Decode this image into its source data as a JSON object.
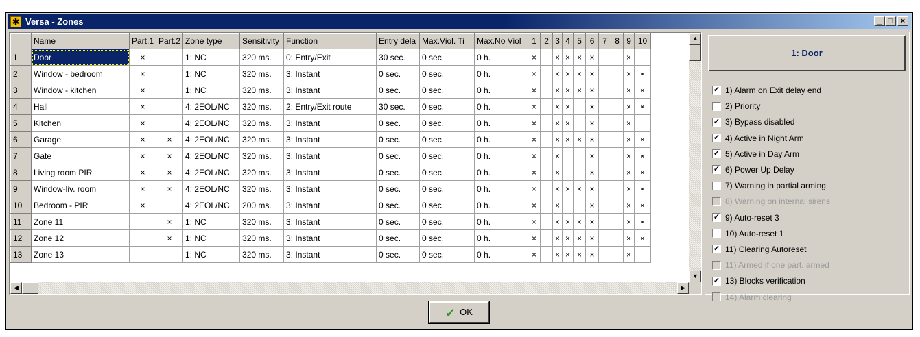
{
  "window": {
    "title": "Versa - Zones",
    "btn_min": "_",
    "btn_max": "□",
    "btn_close": "×"
  },
  "grid": {
    "columns": [
      "Name",
      "Part.1",
      "Part.2",
      "Zone type",
      "Sensitivity",
      "Function",
      "Entry dela",
      "Max.Viol. Ti",
      "Max.No Viol",
      "1",
      "2",
      "3",
      "4",
      "5",
      "6",
      "7",
      "8",
      "9",
      "10"
    ],
    "rows": [
      {
        "num": "1",
        "name": "Door",
        "p1": "×",
        "p2": "",
        "type": "1: NC",
        "sens": "320 ms.",
        "func": "0: Entry/Exit",
        "entry": "30 sec.",
        "maxviol": "0 sec.",
        "maxnoviol": "0 h.",
        "opts": [
          "×",
          "",
          "×",
          "×",
          "×",
          "×",
          "",
          "",
          "×",
          ""
        ]
      },
      {
        "num": "2",
        "name": "Window - bedroom",
        "p1": "×",
        "p2": "",
        "type": "1: NC",
        "sens": "320 ms.",
        "func": "3: Instant",
        "entry": "0 sec.",
        "maxviol": "0 sec.",
        "maxnoviol": "0 h.",
        "opts": [
          "×",
          "",
          "×",
          "×",
          "×",
          "×",
          "",
          "",
          "×",
          "×"
        ]
      },
      {
        "num": "3",
        "name": "Window - kitchen",
        "p1": "×",
        "p2": "",
        "type": "1: NC",
        "sens": "320 ms.",
        "func": "3: Instant",
        "entry": "0 sec.",
        "maxviol": "0 sec.",
        "maxnoviol": "0 h.",
        "opts": [
          "×",
          "",
          "×",
          "×",
          "×",
          "×",
          "",
          "",
          "×",
          "×"
        ]
      },
      {
        "num": "4",
        "name": "Hall",
        "p1": "×",
        "p2": "",
        "type": "4: 2EOL/NC",
        "sens": "320 ms.",
        "func": "2: Entry/Exit route",
        "entry": "30 sec.",
        "maxviol": "0 sec.",
        "maxnoviol": "0 h.",
        "opts": [
          "×",
          "",
          "×",
          "×",
          "",
          "×",
          "",
          "",
          "×",
          "×"
        ]
      },
      {
        "num": "5",
        "name": "Kitchen",
        "p1": "×",
        "p2": "",
        "type": "4: 2EOL/NC",
        "sens": "320 ms.",
        "func": "3: Instant",
        "entry": "0 sec.",
        "maxviol": "0 sec.",
        "maxnoviol": "0 h.",
        "opts": [
          "×",
          "",
          "×",
          "×",
          "",
          "×",
          "",
          "",
          "×",
          ""
        ]
      },
      {
        "num": "6",
        "name": "Garage",
        "p1": "×",
        "p2": "×",
        "type": "4: 2EOL/NC",
        "sens": "320 ms.",
        "func": "3: Instant",
        "entry": "0 sec.",
        "maxviol": "0 sec.",
        "maxnoviol": "0 h.",
        "opts": [
          "×",
          "",
          "×",
          "×",
          "×",
          "×",
          "",
          "",
          "×",
          "×"
        ]
      },
      {
        "num": "7",
        "name": "Gate",
        "p1": "×",
        "p2": "×",
        "type": "4: 2EOL/NC",
        "sens": "320 ms.",
        "func": "3: Instant",
        "entry": "0 sec.",
        "maxviol": "0 sec.",
        "maxnoviol": "0 h.",
        "opts": [
          "×",
          "",
          "×",
          "",
          "",
          "×",
          "",
          "",
          "×",
          "×"
        ]
      },
      {
        "num": "8",
        "name": "Living room PIR",
        "p1": "×",
        "p2": "×",
        "type": "4: 2EOL/NC",
        "sens": "320 ms.",
        "func": "3: Instant",
        "entry": "0 sec.",
        "maxviol": "0 sec.",
        "maxnoviol": "0 h.",
        "opts": [
          "×",
          "",
          "×",
          "",
          "",
          "×",
          "",
          "",
          "×",
          "×"
        ]
      },
      {
        "num": "9",
        "name": "Window-liv. room",
        "p1": "×",
        "p2": "×",
        "type": "4: 2EOL/NC",
        "sens": "320 ms.",
        "func": "3: Instant",
        "entry": "0 sec.",
        "maxviol": "0 sec.",
        "maxnoviol": "0 h.",
        "opts": [
          "×",
          "",
          "×",
          "×",
          "×",
          "×",
          "",
          "",
          "×",
          "×"
        ]
      },
      {
        "num": "10",
        "name": "Bedroom - PIR",
        "p1": "×",
        "p2": "",
        "type": "4: 2EOL/NC",
        "sens": "200 ms.",
        "func": "3: Instant",
        "entry": "0 sec.",
        "maxviol": "0 sec.",
        "maxnoviol": "0 h.",
        "opts": [
          "×",
          "",
          "×",
          "",
          "",
          "×",
          "",
          "",
          "×",
          "×"
        ]
      },
      {
        "num": "11",
        "name": "Zone 11",
        "p1": "",
        "p2": "×",
        "type": "1: NC",
        "sens": "320 ms.",
        "func": "3: Instant",
        "entry": "0 sec.",
        "maxviol": "0 sec.",
        "maxnoviol": "0 h.",
        "opts": [
          "×",
          "",
          "×",
          "×",
          "×",
          "×",
          "",
          "",
          "×",
          "×"
        ]
      },
      {
        "num": "12",
        "name": "Zone 12",
        "p1": "",
        "p2": "×",
        "type": "1: NC",
        "sens": "320 ms.",
        "func": "3: Instant",
        "entry": "0 sec.",
        "maxviol": "0 sec.",
        "maxnoviol": "0 h.",
        "opts": [
          "×",
          "",
          "×",
          "×",
          "×",
          "×",
          "",
          "",
          "×",
          "×"
        ]
      },
      {
        "num": "13",
        "name": "Zone 13",
        "p1": "",
        "p2": "",
        "type": "1: NC",
        "sens": "320 ms.",
        "func": "3: Instant",
        "entry": "0 sec.",
        "maxviol": "0 sec.",
        "maxnoviol": "0 h.",
        "opts": [
          "×",
          "",
          "×",
          "×",
          "×",
          "×",
          "",
          "",
          "×",
          ""
        ]
      }
    ]
  },
  "panel": {
    "zone_title": "1: Door",
    "options": [
      {
        "label": "1) Alarm on Exit delay end",
        "checked": true,
        "disabled": false
      },
      {
        "label": "2) Priority",
        "checked": false,
        "disabled": false
      },
      {
        "label": "3) Bypass disabled",
        "checked": true,
        "disabled": false
      },
      {
        "label": "4) Active in Night Arm",
        "checked": true,
        "disabled": false
      },
      {
        "label": "5) Active in Day Arm",
        "checked": true,
        "disabled": false
      },
      {
        "label": "6) Power Up Delay",
        "checked": true,
        "disabled": false
      },
      {
        "label": "7) Warning in partial arming",
        "checked": false,
        "disabled": false
      },
      {
        "label": "8) Warning on internal sirens",
        "checked": false,
        "disabled": true
      },
      {
        "label": "9) Auto-reset 3",
        "checked": true,
        "disabled": false
      },
      {
        "label": "10) Auto-reset 1",
        "checked": false,
        "disabled": false
      },
      {
        "label": "11) Clearing Autoreset",
        "checked": true,
        "disabled": false
      },
      {
        "label": "11) Armed if one part. armed",
        "checked": false,
        "disabled": true
      },
      {
        "label": "13) Blocks verification",
        "checked": true,
        "disabled": false
      },
      {
        "label": "14) Alarm clearing",
        "checked": false,
        "disabled": true
      }
    ]
  },
  "ok_label": "OK",
  "check_mark": "✓",
  "icons": {
    "ok": "green-check-icon",
    "app": "versa-app-icon"
  }
}
